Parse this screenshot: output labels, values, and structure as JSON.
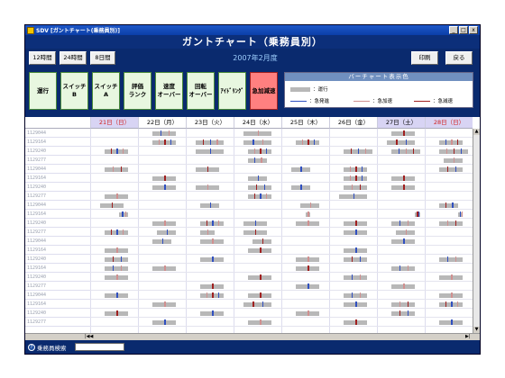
{
  "window": {
    "title": "SDV [ガントチャート(乗務員別)]",
    "controls": {
      "minimize": "_",
      "restore": "□",
      "close": "x"
    }
  },
  "heading": "ガントチャート（乗務員別）",
  "topbar": {
    "range_buttons": [
      "12時間",
      "24時間",
      "8日間"
    ],
    "month": "2007年2月度",
    "print_label": "印刷",
    "back_label": "戻る"
  },
  "filters": [
    {
      "label": "運行",
      "color": "green"
    },
    {
      "label": "スイッチB",
      "color": "green"
    },
    {
      "label": "スイッチA",
      "color": "green"
    },
    {
      "label": "評価\nランク",
      "color": "green"
    },
    {
      "label": "速度\nオーバー",
      "color": "green"
    },
    {
      "label": "回転\nオーバー",
      "color": "green"
    },
    {
      "label": "ｱｲﾄﾞﾘﾝｸﾞ",
      "color": "green"
    },
    {
      "label": "急加減速",
      "color": "red"
    }
  ],
  "legend": {
    "title": "バーチャート表示色",
    "run_label": "：運行",
    "sudden_start_label": "：急発進",
    "sudden_accel_label": "：急加速",
    "sudden_decel_label": "：急減速",
    "colors": {
      "run": "#b8b8b8",
      "sudden_start": "#3050c0",
      "sudden_accel": "#d09090",
      "sudden_decel": "#a02020"
    }
  },
  "days": [
    {
      "label": "21日（日）",
      "type": "sun"
    },
    {
      "label": "22日（月）",
      "type": "wk"
    },
    {
      "label": "23日（火）",
      "type": "wk"
    },
    {
      "label": "24日（水）",
      "type": "wk"
    },
    {
      "label": "25日（木）",
      "type": "wk"
    },
    {
      "label": "26日（金）",
      "type": "wk"
    },
    {
      "label": "27日（土）",
      "type": "sat"
    },
    {
      "label": "28日（日）",
      "type": "sun"
    }
  ],
  "rows": [
    {
      "id": "1129044",
      "spans": [
        [
          1,
          0.3,
          0.8,
          2
        ],
        [
          3,
          0.2,
          0.8,
          1
        ],
        [
          6,
          0.3,
          0.8,
          1
        ]
      ]
    },
    {
      "id": "1129164",
      "spans": [
        [
          1,
          0.3,
          0.8,
          3
        ],
        [
          2,
          0.2,
          0.8,
          3
        ],
        [
          3,
          0.2,
          0.8,
          2
        ],
        [
          4,
          0.3,
          0.8,
          3
        ],
        [
          6,
          0.2,
          0.8,
          2
        ],
        [
          7,
          0.3,
          0.8,
          3
        ]
      ]
    },
    {
      "id": "1129240",
      "spans": [
        [
          0,
          0.3,
          0.8,
          3
        ],
        [
          2,
          0.2,
          0.8,
          1
        ],
        [
          3,
          0.3,
          0.8,
          3
        ],
        [
          5,
          0.3,
          0.9,
          3
        ],
        [
          6,
          0.3,
          0.9,
          3
        ],
        [
          7,
          0.3,
          0.9,
          3
        ]
      ]
    },
    {
      "id": "1129277",
      "spans": [
        [
          3,
          0.3,
          0.7,
          2
        ],
        [
          7,
          0.4,
          0.8,
          1
        ]
      ]
    },
    {
      "id": "1129044",
      "spans": [
        [
          0,
          0.3,
          0.8,
          2
        ],
        [
          2,
          0.2,
          0.7,
          1
        ],
        [
          4,
          0.2,
          0.6,
          1
        ],
        [
          5,
          0.3,
          0.8,
          3
        ],
        [
          7,
          0.3,
          0.8,
          2
        ]
      ]
    },
    {
      "id": "1129164",
      "spans": [
        [
          1,
          0.3,
          0.8,
          1
        ],
        [
          3,
          0.3,
          0.7,
          1
        ],
        [
          5,
          0.3,
          0.8,
          3
        ],
        [
          6,
          0.3,
          0.8,
          1
        ]
      ]
    },
    {
      "id": "1129240",
      "spans": [
        [
          1,
          0.3,
          0.8,
          1
        ],
        [
          2,
          0.2,
          0.7,
          1
        ],
        [
          3,
          0.3,
          0.8,
          2
        ],
        [
          4,
          0.2,
          0.6,
          1
        ],
        [
          5,
          0.3,
          0.8,
          2
        ],
        [
          6,
          0.3,
          0.8,
          1
        ]
      ]
    },
    {
      "id": "1129277",
      "spans": [
        [
          0,
          0.3,
          0.8,
          1
        ],
        [
          3,
          0.3,
          0.8,
          3
        ],
        [
          5,
          0.2,
          0.8,
          1
        ]
      ]
    },
    {
      "id": "1129044",
      "spans": [
        [
          0,
          0.2,
          0.7,
          1
        ],
        [
          2,
          0.3,
          0.7,
          1
        ],
        [
          4,
          0.4,
          0.8,
          1
        ],
        [
          7,
          0.3,
          0.7,
          2
        ]
      ]
    },
    {
      "id": "1129164",
      "spans": [
        [
          0,
          0.6,
          0.8,
          2
        ],
        [
          4,
          0.5,
          0.6,
          1
        ],
        [
          6,
          0.8,
          0.9,
          2
        ],
        [
          7,
          0.7,
          0.8,
          2
        ]
      ]
    },
    {
      "id": "1129240",
      "spans": [
        [
          1,
          0.3,
          0.8,
          1
        ],
        [
          2,
          0.3,
          0.8,
          3
        ],
        [
          3,
          0.2,
          0.7,
          1
        ],
        [
          4,
          0.3,
          0.8,
          1
        ],
        [
          5,
          0.3,
          0.8,
          1
        ],
        [
          6,
          0.3,
          0.8,
          2
        ],
        [
          7,
          0.3,
          0.8,
          2
        ]
      ]
    },
    {
      "id": "1129277",
      "spans": [
        [
          0,
          0.3,
          0.8,
          3
        ],
        [
          1,
          0.4,
          0.8,
          1
        ],
        [
          2,
          0.3,
          0.6,
          1
        ],
        [
          3,
          0.2,
          0.7,
          1
        ],
        [
          5,
          0.3,
          0.8,
          1
        ],
        [
          6,
          0.4,
          0.8,
          1
        ]
      ]
    },
    {
      "id": "1129044",
      "spans": [
        [
          1,
          0.3,
          0.7,
          1
        ],
        [
          2,
          0.3,
          0.8,
          1
        ],
        [
          3,
          0.4,
          0.8,
          1
        ],
        [
          6,
          0.3,
          0.8,
          1
        ]
      ]
    },
    {
      "id": "1129164",
      "spans": [
        [
          0,
          0.3,
          0.8,
          1
        ],
        [
          3,
          0.3,
          0.8,
          1
        ],
        [
          5,
          0.3,
          0.8,
          1
        ]
      ]
    },
    {
      "id": "1129240",
      "spans": [
        [
          0,
          0.3,
          0.8,
          2
        ],
        [
          2,
          0.3,
          0.8,
          1
        ],
        [
          4,
          0.3,
          0.8,
          1
        ],
        [
          5,
          0.3,
          0.8,
          2
        ],
        [
          7,
          0.3,
          0.8,
          2
        ]
      ]
    },
    {
      "id": "1129164",
      "spans": [
        [
          0,
          0.3,
          0.8,
          2
        ],
        [
          1,
          0.3,
          0.8,
          1
        ],
        [
          4,
          0.3,
          0.8,
          1
        ],
        [
          6,
          0.3,
          0.8,
          2
        ]
      ]
    },
    {
      "id": "1129240",
      "spans": [
        [
          0,
          0.3,
          0.8,
          1
        ],
        [
          3,
          0.3,
          0.8,
          1
        ],
        [
          5,
          0.3,
          0.8,
          2
        ],
        [
          7,
          0.3,
          0.8,
          1
        ]
      ]
    },
    {
      "id": "1129277",
      "spans": [
        [
          2,
          0.3,
          0.8,
          1
        ],
        [
          4,
          0.3,
          0.8,
          1
        ],
        [
          6,
          0.3,
          0.8,
          1
        ]
      ]
    },
    {
      "id": "1129044",
      "spans": [
        [
          0,
          0.3,
          0.8,
          1
        ],
        [
          2,
          0.3,
          0.8,
          3
        ],
        [
          3,
          0.3,
          0.8,
          1
        ],
        [
          5,
          0.3,
          0.8,
          2
        ],
        [
          7,
          0.3,
          0.8,
          1
        ]
      ]
    },
    {
      "id": "1129164",
      "spans": [
        [
          1,
          0.3,
          0.8,
          1
        ],
        [
          3,
          0.2,
          0.8,
          2
        ],
        [
          5,
          0.3,
          0.8,
          1
        ],
        [
          6,
          0.3,
          0.8,
          2
        ],
        [
          7,
          0.3,
          0.8,
          3
        ]
      ]
    },
    {
      "id": "1129240",
      "spans": [
        [
          0,
          0.3,
          0.8,
          1
        ],
        [
          2,
          0.3,
          0.8,
          1
        ],
        [
          4,
          0.3,
          0.8,
          1
        ],
        [
          6,
          0.3,
          0.8,
          2
        ]
      ]
    },
    {
      "id": "1129277",
      "spans": [
        [
          1,
          0.3,
          0.8,
          1
        ],
        [
          3,
          0.3,
          0.8,
          1
        ],
        [
          5,
          0.3,
          0.8,
          1
        ],
        [
          7,
          0.3,
          0.8,
          1
        ]
      ]
    }
  ],
  "scroll": {
    "up": "▲",
    "down": "▼",
    "left_nav": "|◀◀",
    "right_nav": "▶|"
  },
  "status": {
    "search_label": "乗務員検索",
    "search_value": ""
  }
}
